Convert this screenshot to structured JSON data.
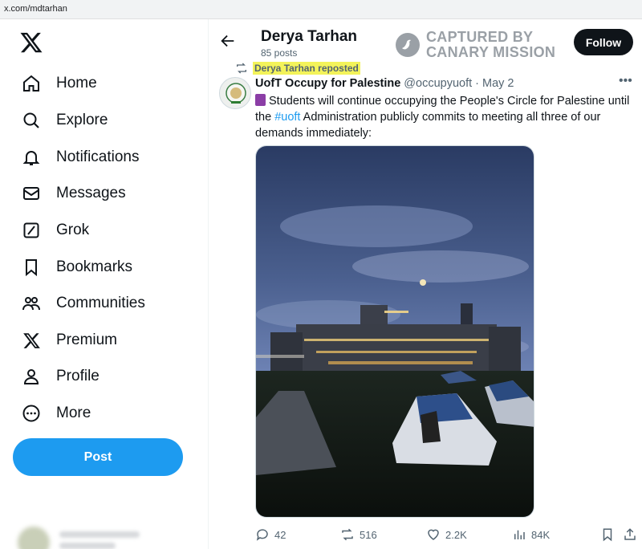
{
  "browser": {
    "url": "x.com/mdtarhan"
  },
  "nav": {
    "items": [
      {
        "label": "Home",
        "icon": "home-icon"
      },
      {
        "label": "Explore",
        "icon": "search-icon"
      },
      {
        "label": "Notifications",
        "icon": "bell-icon"
      },
      {
        "label": "Messages",
        "icon": "mail-icon"
      },
      {
        "label": "Grok",
        "icon": "grok-icon"
      },
      {
        "label": "Bookmarks",
        "icon": "bookmark-icon"
      },
      {
        "label": "Communities",
        "icon": "people-icon"
      },
      {
        "label": "Premium",
        "icon": "x-logo-icon"
      },
      {
        "label": "Profile",
        "icon": "person-icon"
      },
      {
        "label": "More",
        "icon": "more-circle-icon"
      }
    ],
    "post_label": "Post"
  },
  "profile_header": {
    "name": "Derya Tarhan",
    "post_count": "85 posts",
    "follow_label": "Follow"
  },
  "watermark": {
    "line1": "CAPTURED BY",
    "line2": "CANARY MISSION"
  },
  "tweet": {
    "repost_label": "Derya Tarhan reposted",
    "author_name": "UofT Occupy for Palestine",
    "handle": "@occupyuoft",
    "separator": "·",
    "date": "May 2",
    "text_part1": "Students will continue occupying the People's Circle for Palestine until the ",
    "hashtag": "#uoft",
    "text_part2": " Administration publicly commits to meeting all three of our demands immediately:",
    "replies": "42",
    "reposts": "516",
    "likes": "2.2K",
    "views": "84K"
  },
  "colors": {
    "accent": "#1d9bf0",
    "highlight": "#f3f35a",
    "text": "#0f1419",
    "muted": "#536471"
  }
}
